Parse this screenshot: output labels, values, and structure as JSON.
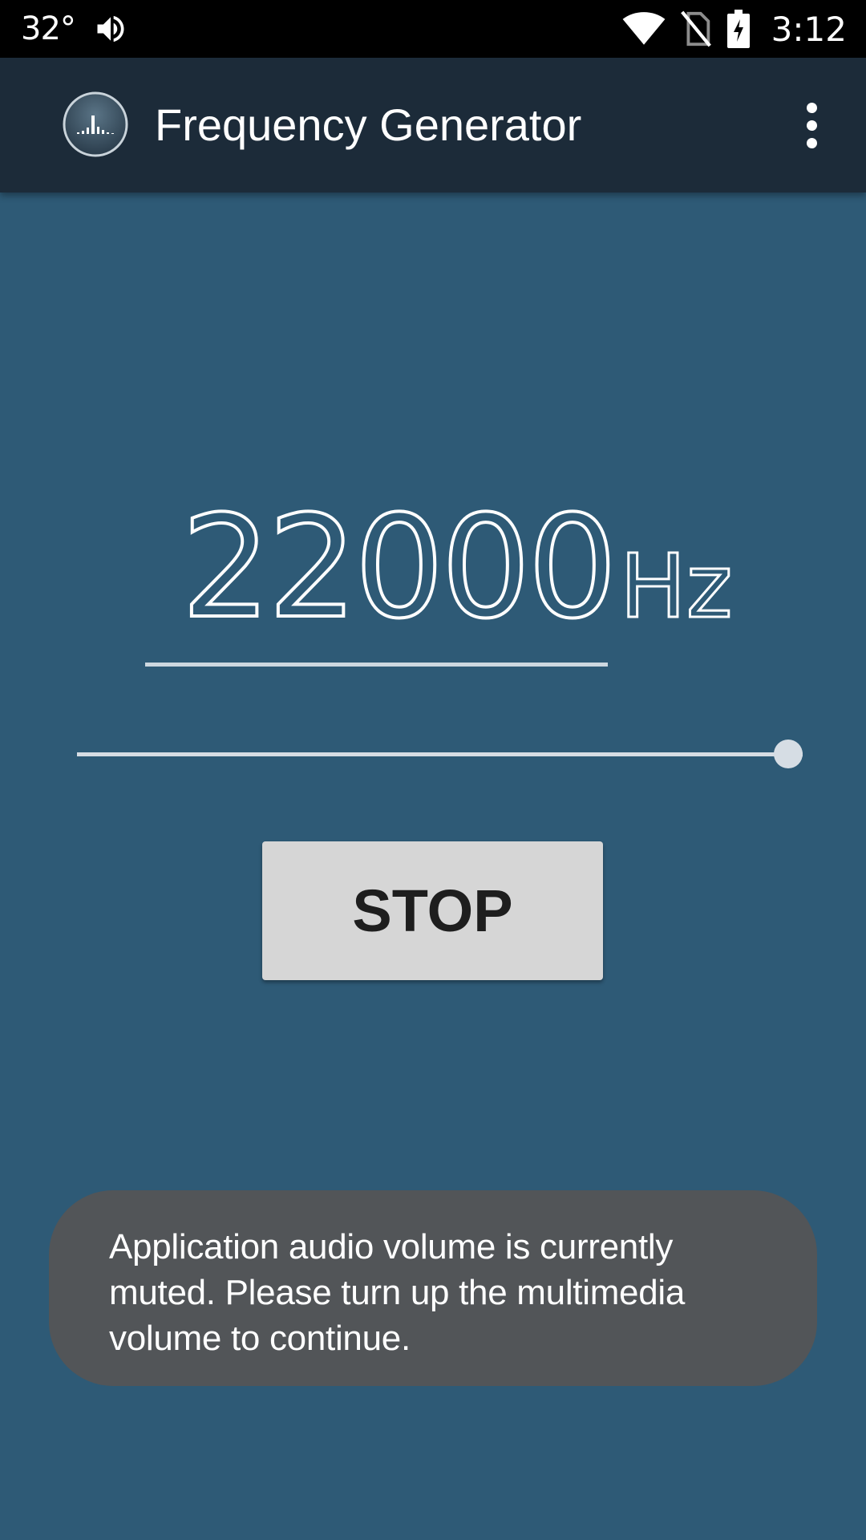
{
  "status_bar": {
    "temperature": "32°",
    "time": "3:12",
    "icons": [
      "volume-icon",
      "wifi-icon",
      "no-sim-icon",
      "battery-charging-icon"
    ]
  },
  "app_bar": {
    "title": "Frequency Generator",
    "logo_icon": "frequency-bars-logo",
    "menu_icon": "overflow-menu-icon"
  },
  "frequency": {
    "value": "22000",
    "unit": "Hz"
  },
  "slider": {
    "level_fraction": 1.0
  },
  "stop_button": {
    "label": "STOP"
  },
  "toast": {
    "message": "Application audio volume is currently muted. Please turn up the multimedia volume to continue."
  },
  "colors": {
    "background": "#2e5a76",
    "app_bar": "#1c2b39",
    "status_bar": "#000000",
    "button": "#d6d6d6",
    "toast": "#525558",
    "slider": "#d6dde4"
  }
}
